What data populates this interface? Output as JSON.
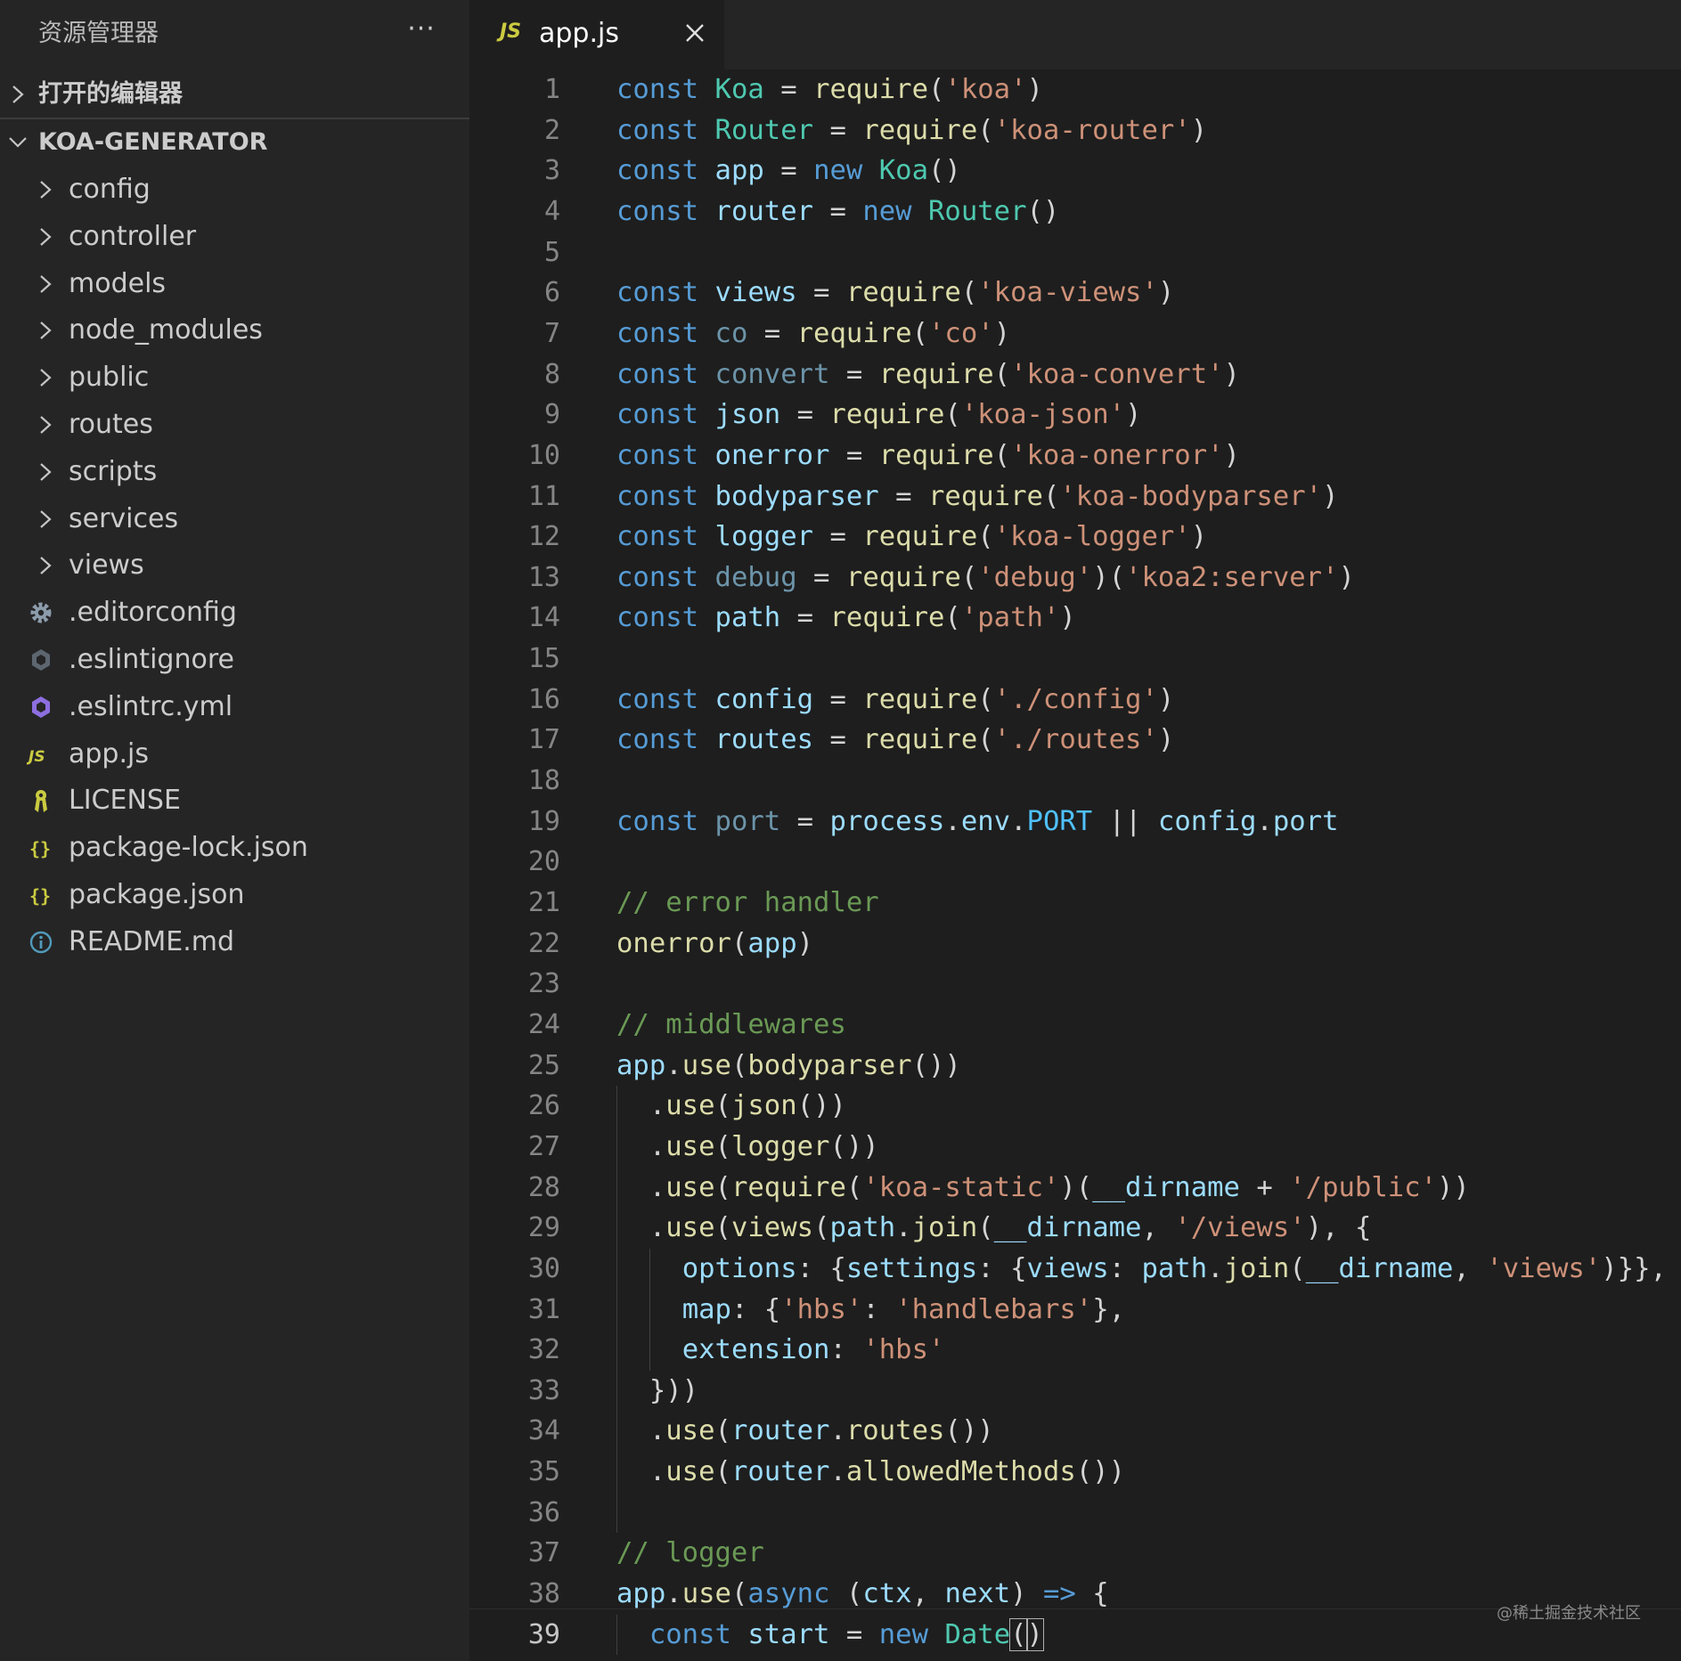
{
  "sidebar": {
    "title": "资源管理器",
    "more_label": "···",
    "open_editors_label": "打开的编辑器",
    "project_label": "KOA-GENERATOR",
    "items": [
      {
        "label": "config",
        "kind": "folder"
      },
      {
        "label": "controller",
        "kind": "folder"
      },
      {
        "label": "models",
        "kind": "folder"
      },
      {
        "label": "node_modules",
        "kind": "folder"
      },
      {
        "label": "public",
        "kind": "folder"
      },
      {
        "label": "routes",
        "kind": "folder"
      },
      {
        "label": "scripts",
        "kind": "folder"
      },
      {
        "label": "services",
        "kind": "folder"
      },
      {
        "label": "views",
        "kind": "folder"
      },
      {
        "label": ".editorconfig",
        "kind": "file",
        "icon": "gear-icon"
      },
      {
        "label": ".eslintignore",
        "kind": "file",
        "icon": "eslint-ignore-icon"
      },
      {
        "label": ".eslintrc.yml",
        "kind": "file",
        "icon": "eslint-icon"
      },
      {
        "label": "app.js",
        "kind": "file",
        "icon": "javascript-icon"
      },
      {
        "label": "LICENSE",
        "kind": "file",
        "icon": "license-icon"
      },
      {
        "label": "package-lock.json",
        "kind": "file",
        "icon": "json-icon"
      },
      {
        "label": "package.json",
        "kind": "file",
        "icon": "json-icon"
      },
      {
        "label": "README.md",
        "kind": "file",
        "icon": "info-icon"
      }
    ]
  },
  "tab": {
    "icon_text": "JS",
    "label": "app.js"
  },
  "editor": {
    "active_line": 39,
    "lines": [
      [
        [
          "kw",
          "const"
        ],
        [
          "pl",
          " "
        ],
        [
          "cls",
          "Koa"
        ],
        [
          "pl",
          " = "
        ],
        [
          "fn",
          "require"
        ],
        [
          "pl",
          "("
        ],
        [
          "str",
          "'koa'"
        ],
        [
          "pl",
          ")"
        ]
      ],
      [
        [
          "kw",
          "const"
        ],
        [
          "pl",
          " "
        ],
        [
          "cls",
          "Router"
        ],
        [
          "pl",
          " = "
        ],
        [
          "fn",
          "require"
        ],
        [
          "pl",
          "("
        ],
        [
          "str",
          "'koa-router'"
        ],
        [
          "pl",
          ")"
        ]
      ],
      [
        [
          "kw",
          "const"
        ],
        [
          "pl",
          " "
        ],
        [
          "var",
          "app"
        ],
        [
          "pl",
          " = "
        ],
        [
          "kw",
          "new"
        ],
        [
          "pl",
          " "
        ],
        [
          "cls",
          "Koa"
        ],
        [
          "pl",
          "()"
        ]
      ],
      [
        [
          "kw",
          "const"
        ],
        [
          "pl",
          " "
        ],
        [
          "var",
          "router"
        ],
        [
          "pl",
          " = "
        ],
        [
          "kw",
          "new"
        ],
        [
          "pl",
          " "
        ],
        [
          "cls",
          "Router"
        ],
        [
          "pl",
          "()"
        ]
      ],
      [],
      [
        [
          "kw",
          "const"
        ],
        [
          "pl",
          " "
        ],
        [
          "var",
          "views"
        ],
        [
          "pl",
          " = "
        ],
        [
          "fn",
          "require"
        ],
        [
          "pl",
          "("
        ],
        [
          "str",
          "'koa-views'"
        ],
        [
          "pl",
          ")"
        ]
      ],
      [
        [
          "kw",
          "const"
        ],
        [
          "pl",
          " "
        ],
        [
          "dim",
          "co"
        ],
        [
          "pl",
          " = "
        ],
        [
          "fn",
          "require"
        ],
        [
          "pl",
          "("
        ],
        [
          "str",
          "'co'"
        ],
        [
          "pl",
          ")"
        ]
      ],
      [
        [
          "kw",
          "const"
        ],
        [
          "pl",
          " "
        ],
        [
          "dim",
          "convert"
        ],
        [
          "pl",
          " = "
        ],
        [
          "fn",
          "require"
        ],
        [
          "pl",
          "("
        ],
        [
          "str",
          "'koa-convert'"
        ],
        [
          "pl",
          ")"
        ]
      ],
      [
        [
          "kw",
          "const"
        ],
        [
          "pl",
          " "
        ],
        [
          "var",
          "json"
        ],
        [
          "pl",
          " = "
        ],
        [
          "fn",
          "require"
        ],
        [
          "pl",
          "("
        ],
        [
          "str",
          "'koa-json'"
        ],
        [
          "pl",
          ")"
        ]
      ],
      [
        [
          "kw",
          "const"
        ],
        [
          "pl",
          " "
        ],
        [
          "var",
          "onerror"
        ],
        [
          "pl",
          " = "
        ],
        [
          "fn",
          "require"
        ],
        [
          "pl",
          "("
        ],
        [
          "str",
          "'koa-onerror'"
        ],
        [
          "pl",
          ")"
        ]
      ],
      [
        [
          "kw",
          "const"
        ],
        [
          "pl",
          " "
        ],
        [
          "var",
          "bodyparser"
        ],
        [
          "pl",
          " = "
        ],
        [
          "fn",
          "require"
        ],
        [
          "pl",
          "("
        ],
        [
          "str",
          "'koa-bodyparser'"
        ],
        [
          "pl",
          ")"
        ]
      ],
      [
        [
          "kw",
          "const"
        ],
        [
          "pl",
          " "
        ],
        [
          "var",
          "logger"
        ],
        [
          "pl",
          " = "
        ],
        [
          "fn",
          "require"
        ],
        [
          "pl",
          "("
        ],
        [
          "str",
          "'koa-logger'"
        ],
        [
          "pl",
          ")"
        ]
      ],
      [
        [
          "kw",
          "const"
        ],
        [
          "pl",
          " "
        ],
        [
          "dim",
          "debug"
        ],
        [
          "pl",
          " = "
        ],
        [
          "fn",
          "require"
        ],
        [
          "pl",
          "("
        ],
        [
          "str",
          "'debug'"
        ],
        [
          "pl",
          ")("
        ],
        [
          "str",
          "'koa2:server'"
        ],
        [
          "pl",
          ")"
        ]
      ],
      [
        [
          "kw",
          "const"
        ],
        [
          "pl",
          " "
        ],
        [
          "var",
          "path"
        ],
        [
          "pl",
          " = "
        ],
        [
          "fn",
          "require"
        ],
        [
          "pl",
          "("
        ],
        [
          "str",
          "'path'"
        ],
        [
          "pl",
          ")"
        ]
      ],
      [],
      [
        [
          "kw",
          "const"
        ],
        [
          "pl",
          " "
        ],
        [
          "var",
          "config"
        ],
        [
          "pl",
          " = "
        ],
        [
          "fn",
          "require"
        ],
        [
          "pl",
          "("
        ],
        [
          "str",
          "'./config'"
        ],
        [
          "pl",
          ")"
        ]
      ],
      [
        [
          "kw",
          "const"
        ],
        [
          "pl",
          " "
        ],
        [
          "var",
          "routes"
        ],
        [
          "pl",
          " = "
        ],
        [
          "fn",
          "require"
        ],
        [
          "pl",
          "("
        ],
        [
          "str",
          "'./routes'"
        ],
        [
          "pl",
          ")"
        ]
      ],
      [],
      [
        [
          "kw",
          "const"
        ],
        [
          "pl",
          " "
        ],
        [
          "dim",
          "port"
        ],
        [
          "pl",
          " = "
        ],
        [
          "var",
          "process"
        ],
        [
          "pl",
          "."
        ],
        [
          "var",
          "env"
        ],
        [
          "pl",
          "."
        ],
        [
          "cst",
          "PORT"
        ],
        [
          "pl",
          " || "
        ],
        [
          "var",
          "config"
        ],
        [
          "pl",
          "."
        ],
        [
          "var",
          "port"
        ]
      ],
      [],
      [
        [
          "com",
          "// error handler"
        ]
      ],
      [
        [
          "fn",
          "onerror"
        ],
        [
          "pl",
          "("
        ],
        [
          "var",
          "app"
        ],
        [
          "pl",
          ")"
        ]
      ],
      [],
      [
        [
          "com",
          "// middlewares"
        ]
      ],
      [
        [
          "var",
          "app"
        ],
        [
          "pl",
          "."
        ],
        [
          "fn",
          "use"
        ],
        [
          "pl",
          "("
        ],
        [
          "fn",
          "bodyparser"
        ],
        [
          "pl",
          "())"
        ]
      ],
      [
        [
          "pl",
          "  ."
        ],
        [
          "fn",
          "use"
        ],
        [
          "pl",
          "("
        ],
        [
          "fn",
          "json"
        ],
        [
          "pl",
          "())"
        ]
      ],
      [
        [
          "pl",
          "  ."
        ],
        [
          "fn",
          "use"
        ],
        [
          "pl",
          "("
        ],
        [
          "fn",
          "logger"
        ],
        [
          "pl",
          "())"
        ]
      ],
      [
        [
          "pl",
          "  ."
        ],
        [
          "fn",
          "use"
        ],
        [
          "pl",
          "("
        ],
        [
          "fn",
          "require"
        ],
        [
          "pl",
          "("
        ],
        [
          "str",
          "'koa-static'"
        ],
        [
          "pl",
          ")("
        ],
        [
          "var",
          "__dirname"
        ],
        [
          "pl",
          " + "
        ],
        [
          "str",
          "'/public'"
        ],
        [
          "pl",
          "))"
        ]
      ],
      [
        [
          "pl",
          "  ."
        ],
        [
          "fn",
          "use"
        ],
        [
          "pl",
          "("
        ],
        [
          "fn",
          "views"
        ],
        [
          "pl",
          "("
        ],
        [
          "var",
          "path"
        ],
        [
          "pl",
          "."
        ],
        [
          "fn",
          "join"
        ],
        [
          "pl",
          "("
        ],
        [
          "var",
          "__dirname"
        ],
        [
          "pl",
          ", "
        ],
        [
          "str",
          "'/views'"
        ],
        [
          "pl",
          "), {"
        ]
      ],
      [
        [
          "pl",
          "    "
        ],
        [
          "var",
          "options"
        ],
        [
          "pl",
          ": {"
        ],
        [
          "var",
          "settings"
        ],
        [
          "pl",
          ": {"
        ],
        [
          "var",
          "views"
        ],
        [
          "pl",
          ": "
        ],
        [
          "var",
          "path"
        ],
        [
          "pl",
          "."
        ],
        [
          "fn",
          "join"
        ],
        [
          "pl",
          "("
        ],
        [
          "var",
          "__dirname"
        ],
        [
          "pl",
          ", "
        ],
        [
          "str",
          "'views'"
        ],
        [
          "pl",
          ")}},"
        ]
      ],
      [
        [
          "pl",
          "    "
        ],
        [
          "var",
          "map"
        ],
        [
          "pl",
          ": {"
        ],
        [
          "str",
          "'hbs'"
        ],
        [
          "pl",
          ": "
        ],
        [
          "str",
          "'handlebars'"
        ],
        [
          "pl",
          "},"
        ]
      ],
      [
        [
          "pl",
          "    "
        ],
        [
          "var",
          "extension"
        ],
        [
          "pl",
          ": "
        ],
        [
          "str",
          "'hbs'"
        ]
      ],
      [
        [
          "pl",
          "  }))"
        ]
      ],
      [
        [
          "pl",
          "  ."
        ],
        [
          "fn",
          "use"
        ],
        [
          "pl",
          "("
        ],
        [
          "var",
          "router"
        ],
        [
          "pl",
          "."
        ],
        [
          "fn",
          "routes"
        ],
        [
          "pl",
          "())"
        ]
      ],
      [
        [
          "pl",
          "  ."
        ],
        [
          "fn",
          "use"
        ],
        [
          "pl",
          "("
        ],
        [
          "var",
          "router"
        ],
        [
          "pl",
          "."
        ],
        [
          "fn",
          "allowedMethods"
        ],
        [
          "pl",
          "())"
        ]
      ],
      [],
      [
        [
          "com",
          "// logger"
        ]
      ],
      [
        [
          "var",
          "app"
        ],
        [
          "pl",
          "."
        ],
        [
          "fn",
          "use"
        ],
        [
          "pl",
          "("
        ],
        [
          "kw",
          "async"
        ],
        [
          "pl",
          " ("
        ],
        [
          "var",
          "ctx"
        ],
        [
          "pl",
          ", "
        ],
        [
          "var",
          "next"
        ],
        [
          "pl",
          ") "
        ],
        [
          "kw",
          "=>"
        ],
        [
          "pl",
          " {"
        ]
      ],
      [
        [
          "pl",
          "  "
        ],
        [
          "kw",
          "const"
        ],
        [
          "pl",
          " "
        ],
        [
          "var",
          "start"
        ],
        [
          "pl",
          " = "
        ],
        [
          "kw",
          "new"
        ],
        [
          "pl",
          " "
        ],
        [
          "cls",
          "Date"
        ],
        [
          "bm",
          "("
        ],
        [
          "bm",
          ")"
        ]
      ]
    ]
  },
  "watermark": "@稀土掘金技术社区",
  "colors": {
    "sidebar_bg": "#252526",
    "editor_bg": "#1e1e1e",
    "keyword": "#569cd6",
    "class": "#4ec9b0",
    "variable": "#9cdcfe",
    "constant": "#4fc1ff",
    "function": "#dcdcaa",
    "string": "#ce9178",
    "comment": "#6a9955",
    "js_icon": "#cbcb41"
  }
}
